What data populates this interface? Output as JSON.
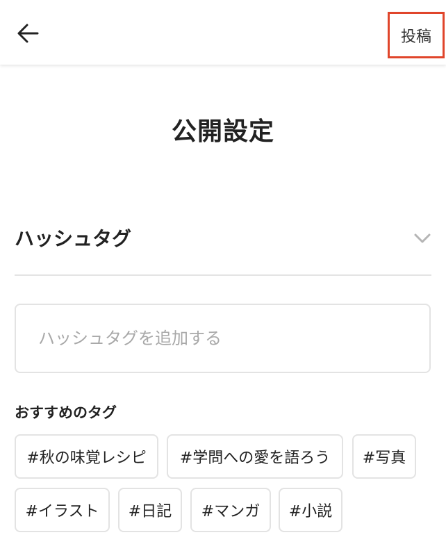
{
  "header": {
    "back_icon": "arrow-left-icon",
    "post_label": "投稿",
    "highlight_color": "#e0452b"
  },
  "page_title": "公開設定",
  "hashtag_section": {
    "title": "ハッシュタグ",
    "toggle_icon": "chevron-down-icon",
    "input_placeholder": "ハッシュタグを追加する",
    "input_value": ""
  },
  "recommended": {
    "label": "おすすめのタグ",
    "tags": [
      "#秋の味覚レシピ",
      "#学問への愛を語ろう",
      "#写真",
      "#イラスト",
      "#日記",
      "#マンガ",
      "#小説"
    ]
  }
}
